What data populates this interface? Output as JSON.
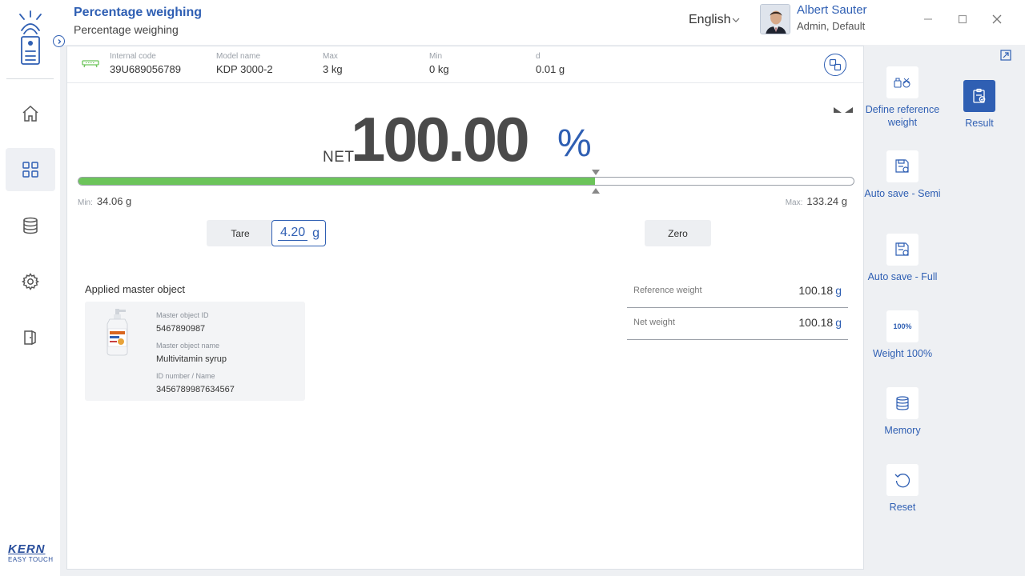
{
  "header": {
    "title": "Percentage weighing",
    "subtitle": "Percentage weighing",
    "language": "English",
    "user_name": "Albert Sauter",
    "user_role": "Admin, Default"
  },
  "brand": {
    "name": "KERN",
    "tagline": "EASY TOUCH"
  },
  "nav": {
    "items": [
      {
        "icon": "home-icon"
      },
      {
        "icon": "apps-icon",
        "active": true
      },
      {
        "icon": "database-icon"
      },
      {
        "icon": "gear-icon"
      },
      {
        "icon": "logout-icon"
      }
    ]
  },
  "info": {
    "internal_code_label": "Internal code",
    "internal_code": "39U689056789",
    "model_label": "Model name",
    "model": "KDP 3000-2",
    "max_label": "Max",
    "max": "3 kg",
    "min_label": "Min",
    "min": "0 kg",
    "d_label": "d",
    "d": "0.01 g"
  },
  "display": {
    "net_label": "NET",
    "value": "100.00",
    "unit": "%",
    "progress_fraction": 0.666,
    "min_label": "Min:",
    "min_value": "34.06 g",
    "max_label": "Max:",
    "max_value": "133.24 g"
  },
  "controls": {
    "tare_label": "Tare",
    "tare_value": "4.20",
    "tare_unit": "g",
    "zero_label": "Zero"
  },
  "master_object": {
    "section_title": "Applied master object",
    "id_label": "Master object ID",
    "id": "5467890987",
    "name_label": "Master object name",
    "name": "Multivitamin syrup",
    "number_label": "ID number / Name",
    "number": "3456789987634567"
  },
  "weights": {
    "reference_label": "Reference weight",
    "reference_value": "100.18",
    "reference_unit": "g",
    "net_label": "Net weight",
    "net_value": "100.18",
    "net_unit": "g"
  },
  "actions": {
    "define_reference": "Define reference weight",
    "result": "Result",
    "auto_save_semi": "Auto save - Semi",
    "auto_save_full": "Auto save - Full",
    "weight_100": "Weight 100%",
    "weight_100_icon_text": "100%",
    "memory": "Memory",
    "reset": "Reset"
  },
  "colors": {
    "accent": "#2f5fb3",
    "progress": "#6cc45a",
    "background": "#eef0f3"
  }
}
